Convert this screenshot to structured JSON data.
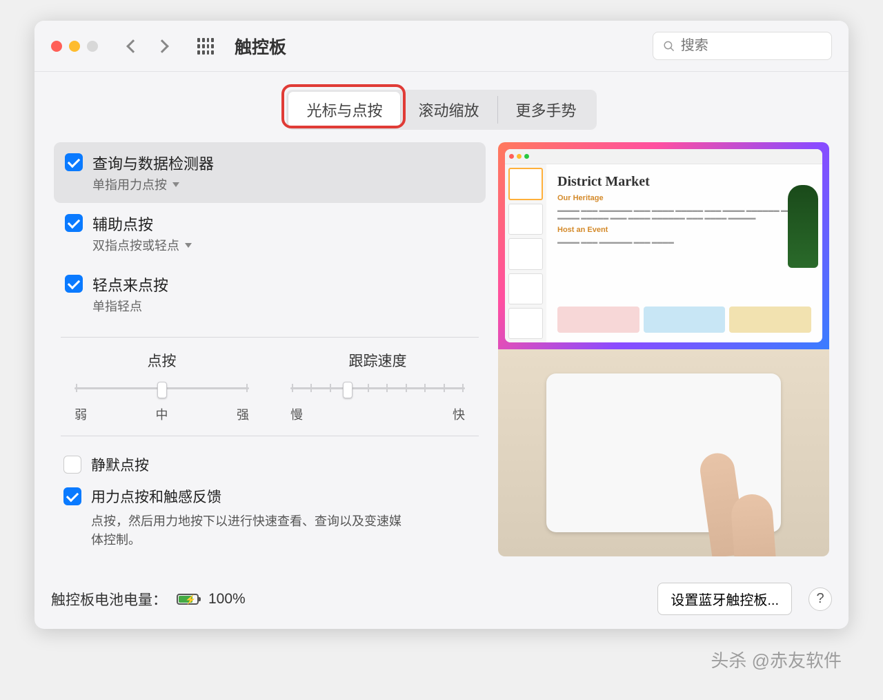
{
  "header": {
    "title": "触控板",
    "search_placeholder": "搜索"
  },
  "tabs": [
    {
      "label": "光标与点按",
      "active": true
    },
    {
      "label": "滚动缩放",
      "active": false
    },
    {
      "label": "更多手势",
      "active": false
    }
  ],
  "options": [
    {
      "title": "查询与数据检测器",
      "sub": "单指用力点按",
      "checked": true,
      "has_menu": true,
      "selected": true
    },
    {
      "title": "辅助点按",
      "sub": "双指点按或轻点",
      "checked": true,
      "has_menu": true,
      "selected": false
    },
    {
      "title": "轻点来点按",
      "sub": "单指轻点",
      "checked": true,
      "has_menu": false,
      "selected": false
    }
  ],
  "sliders": {
    "click": {
      "label": "点按",
      "min_label": "弱",
      "mid_label": "中",
      "max_label": "强",
      "ticks": 3,
      "pos_pct": 50
    },
    "tracking": {
      "label": "跟踪速度",
      "min_label": "慢",
      "mid_label": "",
      "max_label": "快",
      "ticks": 10,
      "pos_pct": 33
    }
  },
  "bottom_options": [
    {
      "title": "静默点按",
      "checked": false,
      "desc": ""
    },
    {
      "title": "用力点按和触感反馈",
      "checked": true,
      "desc": "点按，然后用力地按下以进行快速查看、查询以及变速媒体控制。"
    }
  ],
  "preview": {
    "doc_title": "District Market",
    "doc_sub": "Our Heritage",
    "doc_sub2": "Host an Event",
    "card_colors": [
      "#f7d7d7",
      "#c8e6f5",
      "#f2e2b0"
    ]
  },
  "footer": {
    "battery_label": "触控板电池电量：",
    "battery_pct": "100%",
    "bluetooth_btn": "设置蓝牙触控板...",
    "help": "?"
  },
  "watermark": "头杀 @赤友软件"
}
